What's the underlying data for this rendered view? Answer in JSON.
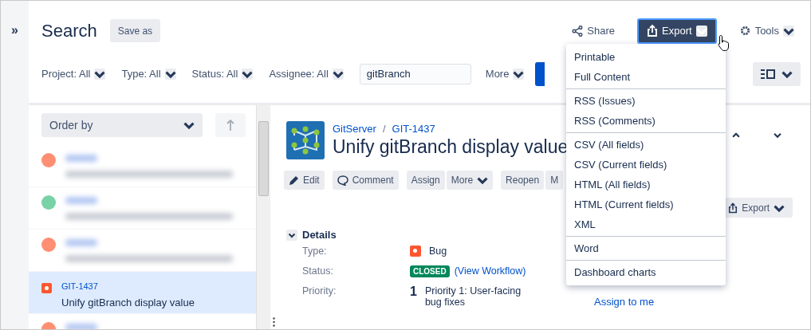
{
  "sidebar_toggle": "»",
  "header": {
    "title": "Search",
    "save_as": "Save as",
    "share": "Share",
    "export": "Export",
    "tools": "Tools"
  },
  "filters": [
    {
      "label": "Project: All"
    },
    {
      "label": "Type: All"
    },
    {
      "label": "Status: All"
    },
    {
      "label": "Assignee: All"
    }
  ],
  "search": {
    "value": "gitBranch"
  },
  "more": "More",
  "order_by": "Order by",
  "issues": [
    {
      "kind": "blurred",
      "color": "#ff8f73",
      "selected": false
    },
    {
      "kind": "blurred",
      "color": "#79d2a6",
      "selected": false
    },
    {
      "kind": "blurred",
      "color": "#ff8f73",
      "selected": false
    },
    {
      "kind": "issue",
      "color": "#ff5630",
      "key": "GIT-1437",
      "summary": "Unify gitBranch display value",
      "selected": true
    },
    {
      "kind": "blurred",
      "color": "#ff8f73",
      "selected": false
    }
  ],
  "issue": {
    "project": "GitServer",
    "separator": "/",
    "key": "GIT-1437",
    "title": "Unify gitBranch display value",
    "actions": [
      {
        "kind": "edit",
        "label": "Edit"
      },
      {
        "kind": "comment",
        "label": "Comment"
      },
      {
        "kind": "plain",
        "label": "Assign"
      },
      {
        "kind": "dropdown",
        "label": "More"
      },
      {
        "kind": "plain",
        "label": "Reopen"
      },
      {
        "kind": "plain",
        "label": "M"
      }
    ],
    "export": "Export",
    "details_heading": "Details",
    "fields": [
      {
        "kind": "type",
        "label": "Type:",
        "value": "Bug"
      },
      {
        "kind": "status",
        "label": "Status:",
        "status": "CLOSED",
        "link": "(View Workflow)"
      },
      {
        "kind": "priority",
        "label": "Priority:",
        "icon": "1",
        "value": "Priority 1: User-facing bug fixes"
      }
    ],
    "assign_to_me": "Assign to me"
  },
  "export_menu": [
    [
      "Printable",
      "Full Content"
    ],
    [
      "RSS (Issues)",
      "RSS (Comments)"
    ],
    [
      "CSV (All fields)",
      "CSV (Current fields)",
      "HTML (All fields)",
      "HTML (Current fields)",
      "XML"
    ],
    [
      "Word"
    ],
    [
      "Dashboard charts"
    ]
  ]
}
